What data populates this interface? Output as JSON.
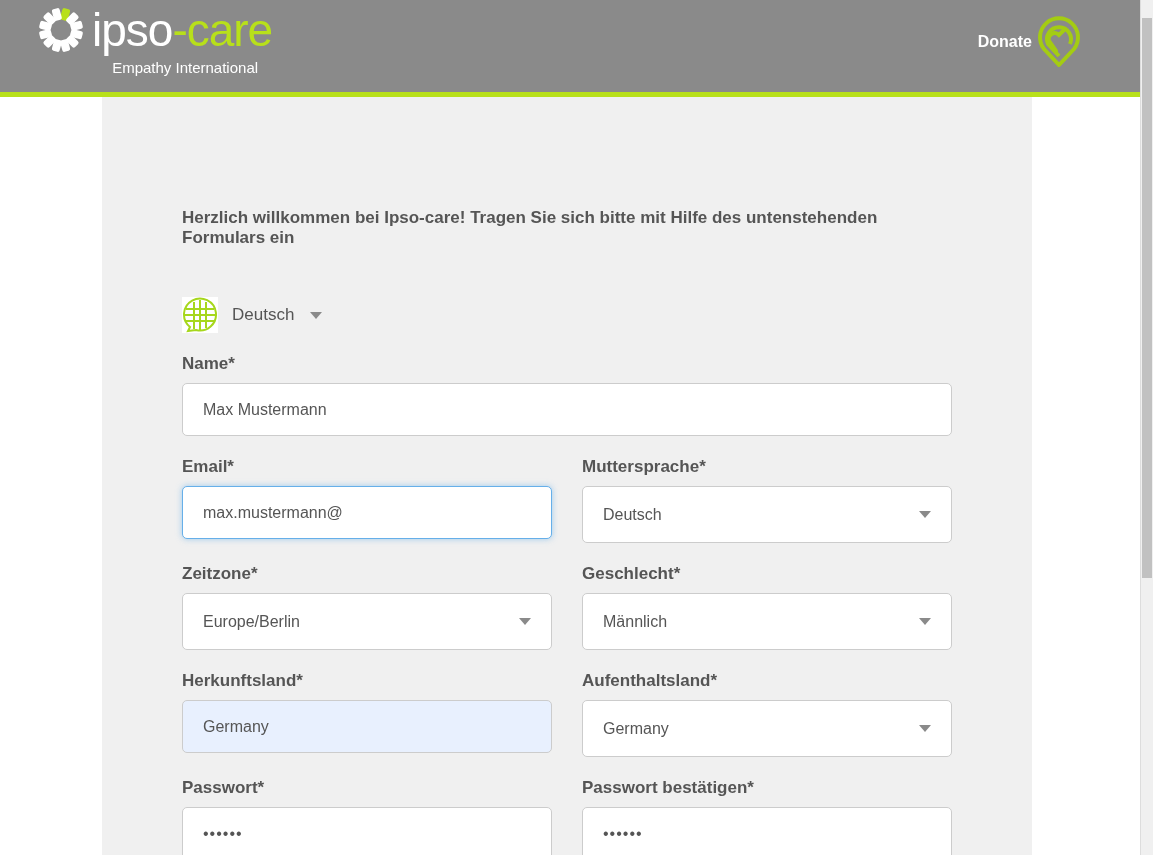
{
  "header": {
    "logo_main": "ipso",
    "logo_accent": "-care",
    "tagline": "Empathy International",
    "donate": "Donate"
  },
  "intro": "Herzlich willkommen bei Ipso-care! Tragen Sie sich bitte mit Hilfe des untenstehenden Formulars ein",
  "language": {
    "value": "Deutsch"
  },
  "fields": [
    {
      "kind": "text",
      "label": "Name*",
      "value": "Max Mustermann",
      "focused": false,
      "autofilled": false,
      "wide": true
    },
    {
      "kind": "text",
      "label": "Email*",
      "value": "max.mustermann@",
      "focused": true,
      "autofilled": false,
      "wide": false
    },
    {
      "kind": "select",
      "label": "Muttersprache*",
      "value": "Deutsch",
      "focused": false,
      "autofilled": false,
      "wide": false
    },
    {
      "kind": "select",
      "label": "Zeitzone*",
      "value": "Europe/Berlin",
      "focused": false,
      "autofilled": false,
      "wide": false
    },
    {
      "kind": "select",
      "label": "Geschlecht*",
      "value": "Männlich",
      "focused": false,
      "autofilled": false,
      "wide": false
    },
    {
      "kind": "text",
      "label": "Herkunftsland*",
      "value": "Germany",
      "focused": false,
      "autofilled": true,
      "wide": false
    },
    {
      "kind": "select",
      "label": "Aufenthaltsland*",
      "value": "Germany",
      "focused": false,
      "autofilled": false,
      "wide": false
    },
    {
      "kind": "password",
      "label": "Passwort*",
      "value": "••••••",
      "focused": false,
      "autofilled": false,
      "wide": false
    },
    {
      "kind": "password",
      "label": "Passwort bestätigen*",
      "value": "••••••",
      "focused": false,
      "autofilled": false,
      "wide": false
    }
  ]
}
